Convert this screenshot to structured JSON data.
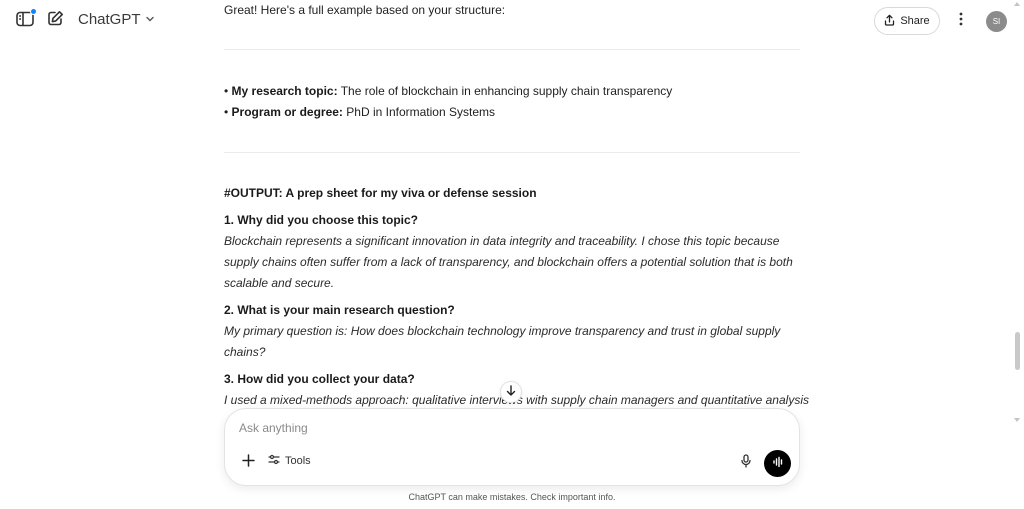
{
  "header": {
    "model_name": "ChatGPT",
    "share_label": "Share",
    "avatar_initials": "SI",
    "notification_color": "#0b84ff"
  },
  "conversation": {
    "intro": "Great! Here's a full example based on your structure:",
    "details": [
      {
        "label": "My research topic:",
        "value": "The role of blockchain in enhancing supply chain transparency"
      },
      {
        "label": "Program or degree:",
        "value": "PhD in Information Systems"
      }
    ],
    "output_heading": "#OUTPUT: A prep sheet for my viva or defense session",
    "questions": [
      {
        "question": "1. Why did you choose this topic?",
        "answer_lines": [
          "Blockchain represents a significant innovation in data integrity and traceability. I chose this topic because",
          "supply chains often suffer from a lack of transparency, and blockchain offers a potential solution that is both",
          "scalable and secure."
        ]
      },
      {
        "question": "2. What is your main research question?",
        "answer_lines": [
          "My primary question is: How does blockchain technology improve transparency and trust in global supply",
          "chains?"
        ]
      },
      {
        "question": "3. How did you collect your data?",
        "answer_lines": [
          "I used a mixed-methods approach: qualitative interviews with supply chain managers and quantitative analysis"
        ]
      }
    ]
  },
  "composer": {
    "placeholder": "Ask anything",
    "tools_label": "Tools"
  },
  "footer": {
    "disclaimer": "ChatGPT can make mistakes. Check important info."
  },
  "icons": {
    "sidebar": "sidebar-toggle-icon",
    "new_chat": "edit-pencil-icon",
    "model_dropdown": "chevron-down-icon",
    "share": "share-upload-icon",
    "more": "vertical-dots-icon",
    "scroll_down": "arrow-down-icon",
    "plus": "plus-icon",
    "tools": "sliders-icon",
    "mic": "microphone-icon",
    "voice": "voice-waveform-icon"
  }
}
